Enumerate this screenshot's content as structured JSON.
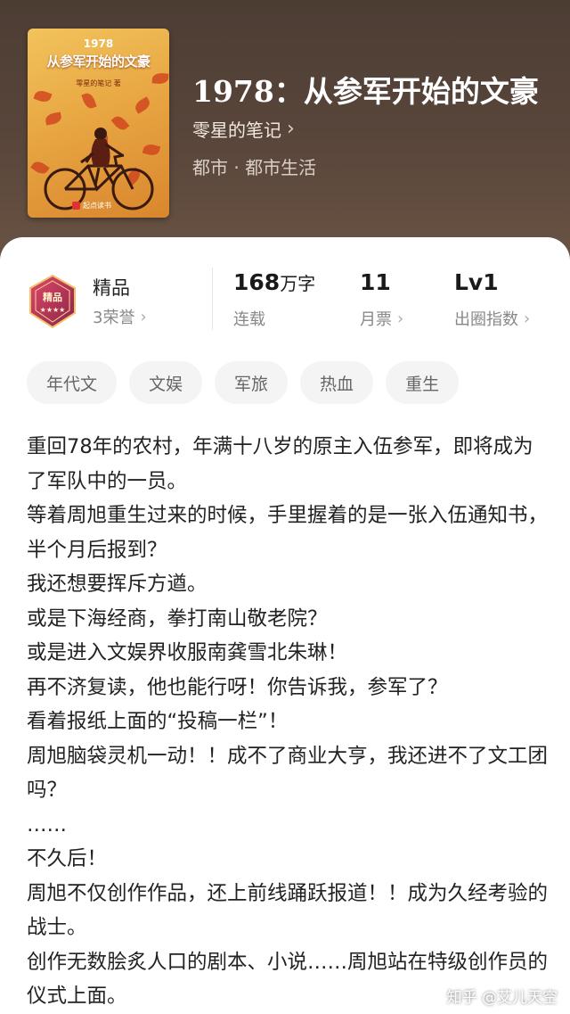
{
  "book": {
    "title": "1978：从参军开始的文豪",
    "author": "零星的笔记",
    "author_chevron": "›",
    "genre": "都市 · 都市生活",
    "cover": {
      "year": "1978",
      "title": "从参军开始的文豪",
      "subtitle": "零星的笔记 著",
      "publisher": "起点读书"
    }
  },
  "stats": {
    "badge": {
      "icon": "premium-badge-icon",
      "label": "精品",
      "sub": "3荣誉"
    },
    "words": {
      "value": "168",
      "unit": "万字",
      "label": "连载"
    },
    "tickets": {
      "value": "11",
      "label": "月票"
    },
    "level": {
      "value": "Lv1",
      "label": "出圈指数"
    }
  },
  "tags": [
    "年代文",
    "文娱",
    "军旅",
    "热血",
    "重生"
  ],
  "description": [
    "重回78年的农村，年满十八岁的原主入伍参军，即将成为了军队中的一员。",
    "等着周旭重生过来的时候，手里握着的是一张入伍通知书，半个月后报到？",
    "我还想要挥斥方遒。",
    "或是下海经商，拳打南山敬老院？",
    "或是进入文娱界收服南龚雪北朱琳！",
    "再不济复读，他也能行呀！你告诉我，参军了？",
    "看着报纸上面的“投稿一栏”！",
    "周旭脑袋灵机一动！！成不了商业大亨，我还进不了文工团吗？",
    "……",
    "不久后！",
    "周旭不仅创作作品，还上前线踊跃报道！！成为久经考验的战士。",
    "创作无数脍炙人口的剧本、小说……周旭站在特级创作员的仪式上面。"
  ],
  "watermark": "知乎 @艾儿天空",
  "colors": {
    "header_bg": "#4c3d34",
    "tag_bg": "#f4f4f4",
    "badge_red": "#c0324a"
  }
}
